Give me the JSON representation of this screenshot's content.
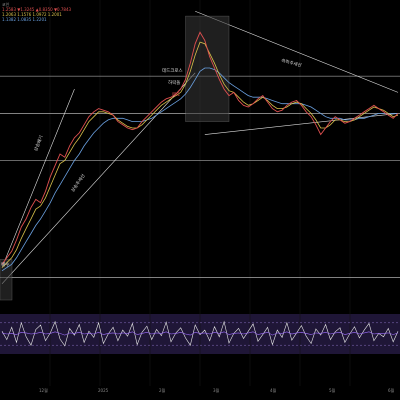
{
  "chart_data": {
    "type": "line",
    "title": "",
    "legend": {
      "symbol": "코인",
      "rows": [
        {
          "text": "1.2583 ▼1.3245 ▲0.8350 ▼0.7843",
          "color": "#e05050"
        },
        {
          "text": "1.2063 1.1576 1.0972 1.2001",
          "color": "#d9c14a"
        },
        {
          "text": "1.1382 1.0835 1.2201",
          "color": "#6aa0e0"
        }
      ]
    },
    "x_ticks": [
      "12월",
      "2025",
      "2월",
      "3월",
      "4월",
      "5월",
      "6월"
    ],
    "price": [
      0.82,
      0.86,
      0.9,
      0.97,
      1.05,
      1.1,
      1.17,
      1.22,
      1.2,
      1.27,
      1.36,
      1.43,
      1.5,
      1.48,
      1.55,
      1.6,
      1.63,
      1.68,
      1.73,
      1.76,
      1.78,
      1.77,
      1.76,
      1.74,
      1.7,
      1.68,
      1.66,
      1.65,
      1.66,
      1.7,
      1.73,
      1.76,
      1.79,
      1.82,
      1.84,
      1.85,
      1.87,
      1.9,
      1.96,
      2.06,
      2.18,
      2.25,
      2.2,
      2.1,
      2.03,
      1.96,
      1.9,
      1.86,
      1.88,
      1.83,
      1.8,
      1.79,
      1.81,
      1.84,
      1.86,
      1.82,
      1.78,
      1.76,
      1.77,
      1.8,
      1.82,
      1.83,
      1.8,
      1.76,
      1.73,
      1.68,
      1.62,
      1.66,
      1.7,
      1.73,
      1.71,
      1.69,
      1.7,
      1.72,
      1.74,
      1.76,
      1.78,
      1.8,
      1.78,
      1.76,
      1.74,
      1.72,
      1.75
    ],
    "ma_short": [
      0.8,
      0.83,
      0.86,
      0.91,
      0.98,
      1.04,
      1.1,
      1.16,
      1.18,
      1.23,
      1.3,
      1.37,
      1.44,
      1.46,
      1.51,
      1.56,
      1.6,
      1.65,
      1.7,
      1.73,
      1.76,
      1.76,
      1.75,
      1.74,
      1.71,
      1.69,
      1.67,
      1.66,
      1.66,
      1.68,
      1.71,
      1.74,
      1.77,
      1.8,
      1.82,
      1.84,
      1.86,
      1.88,
      1.93,
      2.01,
      2.11,
      2.19,
      2.18,
      2.12,
      2.06,
      1.99,
      1.93,
      1.89,
      1.88,
      1.85,
      1.82,
      1.8,
      1.81,
      1.83,
      1.85,
      1.83,
      1.8,
      1.78,
      1.78,
      1.79,
      1.81,
      1.82,
      1.81,
      1.78,
      1.75,
      1.71,
      1.66,
      1.66,
      1.68,
      1.71,
      1.71,
      1.7,
      1.7,
      1.71,
      1.73,
      1.75,
      1.77,
      1.79,
      1.78,
      1.77,
      1.75,
      1.73,
      1.74
    ],
    "ma_long": [
      0.78,
      0.8,
      0.82,
      0.86,
      0.91,
      0.96,
      1.01,
      1.06,
      1.1,
      1.15,
      1.2,
      1.26,
      1.31,
      1.36,
      1.41,
      1.46,
      1.5,
      1.55,
      1.59,
      1.63,
      1.66,
      1.69,
      1.71,
      1.72,
      1.72,
      1.72,
      1.71,
      1.7,
      1.7,
      1.7,
      1.71,
      1.72,
      1.74,
      1.76,
      1.78,
      1.8,
      1.82,
      1.84,
      1.87,
      1.91,
      1.96,
      2.01,
      2.03,
      2.03,
      2.02,
      2.0,
      1.97,
      1.94,
      1.92,
      1.9,
      1.88,
      1.86,
      1.85,
      1.85,
      1.85,
      1.84,
      1.83,
      1.82,
      1.81,
      1.81,
      1.81,
      1.81,
      1.81,
      1.8,
      1.79,
      1.77,
      1.75,
      1.73,
      1.72,
      1.72,
      1.72,
      1.71,
      1.71,
      1.71,
      1.72,
      1.72,
      1.73,
      1.74,
      1.75,
      1.75,
      1.75,
      1.75,
      1.75
    ],
    "y_range": [
      0.6,
      2.4
    ],
    "hlines": [
      1.98,
      1.75,
      1.46,
      0.74
    ],
    "oscillator": [
      55,
      40,
      62,
      35,
      70,
      45,
      30,
      58,
      66,
      38,
      52,
      72,
      41,
      29,
      60,
      48,
      67,
      35,
      55,
      44,
      70,
      33,
      50,
      62,
      38,
      57,
      46,
      69,
      31,
      53,
      64,
      40,
      58,
      47,
      71,
      36,
      52,
      61,
      43,
      30,
      66,
      49,
      57,
      38,
      63,
      45,
      72,
      34,
      51,
      60,
      42,
      55,
      68,
      37,
      49,
      62,
      31,
      57,
      44,
      70,
      39,
      52,
      65,
      46,
      33,
      59,
      48,
      67,
      40,
      54,
      61,
      35,
      50,
      63,
      43,
      57,
      69,
      38,
      51,
      45,
      60,
      36,
      55
    ],
    "osc_signal": [
      52,
      50,
      51,
      49,
      53,
      52,
      50,
      51,
      53,
      50,
      51,
      54,
      51,
      48,
      52,
      51,
      53,
      50,
      51,
      50,
      53,
      49,
      51,
      52,
      50,
      52,
      51,
      54,
      49,
      51,
      53,
      50,
      52,
      51,
      54,
      50,
      51,
      53,
      50,
      48,
      53,
      51,
      52,
      50,
      53,
      51,
      54,
      49,
      51,
      52,
      50,
      52,
      54,
      49,
      51,
      53,
      48,
      52,
      51,
      54,
      50,
      52,
      53,
      51,
      49,
      52,
      51,
      53,
      50,
      52,
      53,
      49,
      51,
      53,
      50,
      52,
      54,
      50,
      51,
      51,
      52,
      49,
      52
    ],
    "osc_range": [
      0,
      100
    ],
    "osc_bands": [
      70,
      30
    ]
  },
  "annotations": {
    "a1": "상승쐐기",
    "a2": "상승추세선",
    "a3": "데드크로스",
    "a4": "하락돌",
    "a5": "매도",
    "a6": "하락추세선",
    "a7": "매수"
  }
}
